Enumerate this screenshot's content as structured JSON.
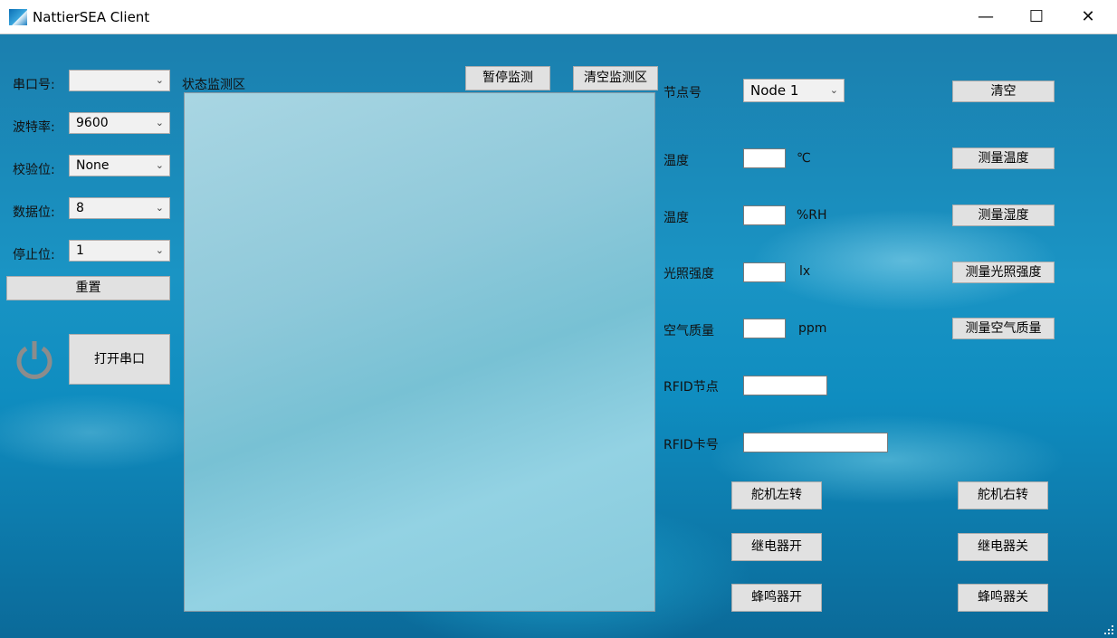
{
  "window": {
    "title": "NattierSEA Client",
    "controls": {
      "minimize": "—",
      "maximize": "☐",
      "close": "✕"
    }
  },
  "serial": {
    "port_label": "串口号:",
    "port_value": "",
    "baud_label": "波特率:",
    "baud_value": "9600",
    "parity_label": "校验位:",
    "parity_value": "None",
    "databits_label": "数据位:",
    "databits_value": "8",
    "stopbits_label": "停止位:",
    "stopbits_value": "1",
    "reset_button": "重置",
    "open_button": "打开串口"
  },
  "monitor": {
    "label": "状态监测区",
    "pause_button": "暂停监测",
    "clear_button": "清空监测区"
  },
  "node": {
    "label": "节点号",
    "value": "Node 1",
    "clear_button": "清空"
  },
  "sensors": [
    {
      "label": "温度",
      "unit": "℃",
      "value": "",
      "button": "测量温度"
    },
    {
      "label": "温度",
      "unit": "%RH",
      "value": "",
      "button": "测量湿度"
    },
    {
      "label": "光照强度",
      "unit": "lx",
      "value": "",
      "button": "测量光照强度"
    },
    {
      "label": "空气质量",
      "unit": "ppm",
      "value": "",
      "button": "测量空气质量"
    }
  ],
  "rfid": {
    "node_label": "RFID节点",
    "node_value": "",
    "card_label": "RFID卡号",
    "card_value": ""
  },
  "actuators": {
    "servo_left": "舵机左转",
    "servo_right": "舵机右转",
    "relay_on": "继电器开",
    "relay_off": "继电器关",
    "buzzer_on": "蜂鸣器开",
    "buzzer_off": "蜂鸣器关"
  },
  "icons": {
    "app": "app-icon",
    "power": "power-icon",
    "dropdown": "chevron-down-icon"
  }
}
